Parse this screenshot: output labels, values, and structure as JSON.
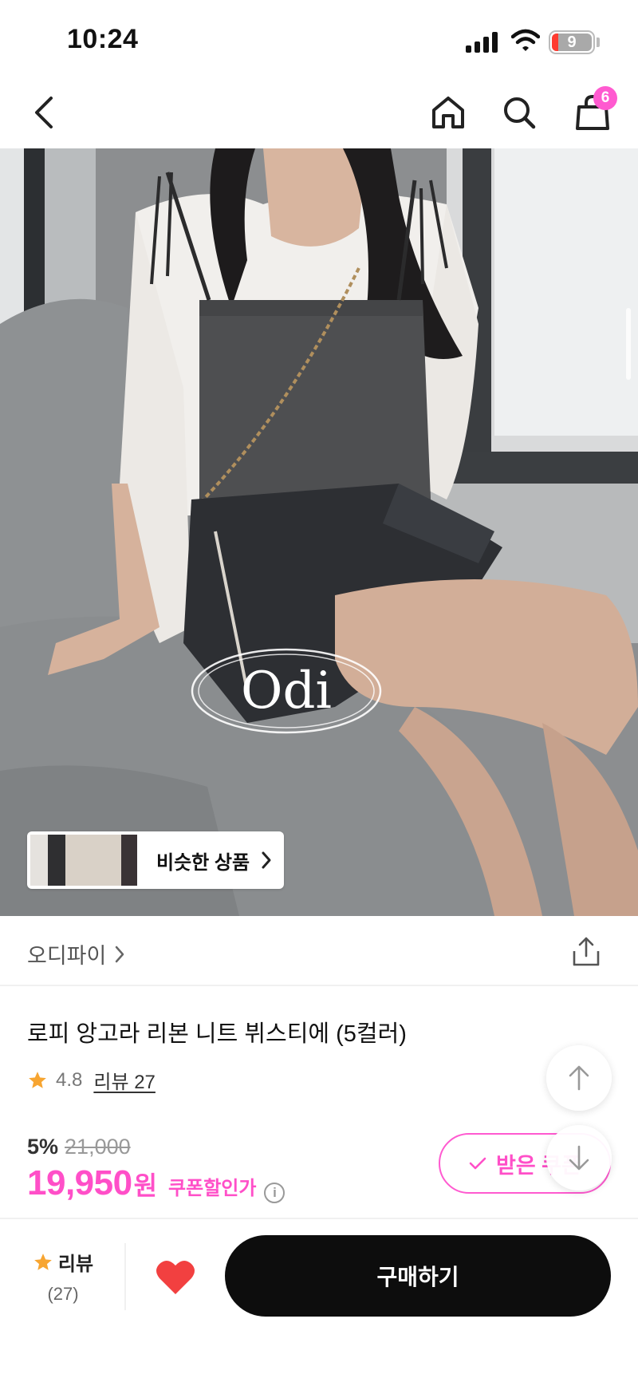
{
  "status_bar": {
    "time": "10:24",
    "battery": "9"
  },
  "nav": {
    "back_icon": "chevron-left-icon",
    "home_icon": "home-icon",
    "search_icon": "search-icon",
    "cart_icon": "shopping-bag-icon",
    "cart_badge": "6"
  },
  "hero": {
    "watermark": "Odi",
    "similar_products_label": "비슷한 상품"
  },
  "seller": {
    "name": "오디파이"
  },
  "product": {
    "title": "로피 앙고라 리본 니트 뷔스티에 (5컬러)",
    "rating": "4.8",
    "review_link": "리뷰 27",
    "discount": "5%",
    "original_price": "21,000",
    "price": "19,950",
    "currency": "원",
    "coupon_price_label": "쿠폰할인가",
    "coupon_button": "받은 쿠폰"
  },
  "bottom_bar": {
    "review_label": "리뷰",
    "review_count": "(27)",
    "buy_label": "구매하기"
  },
  "colors": {
    "accent": "#ff4fc8",
    "badge": "#ff5ad0",
    "heart": "#f24040",
    "star": "#f7a531",
    "buy_button": "#0d0d0d"
  }
}
